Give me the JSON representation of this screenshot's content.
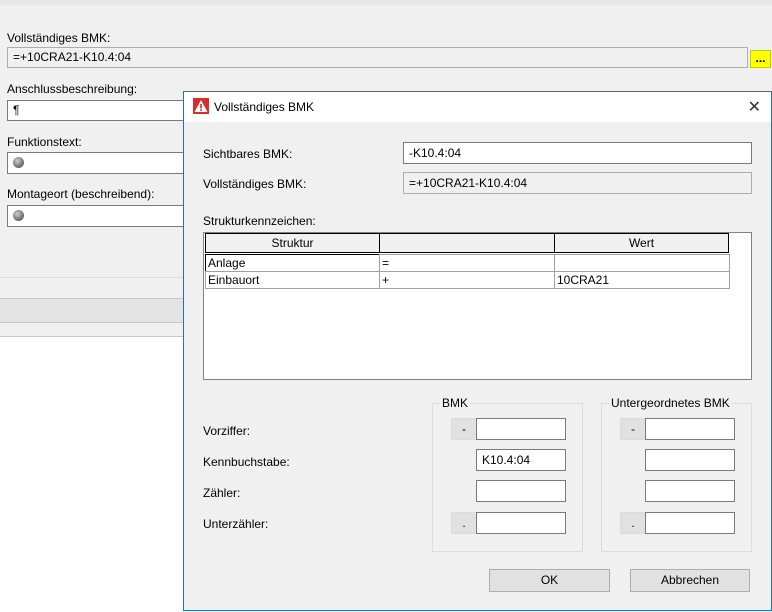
{
  "background_form": {
    "bmk_label": "Vollständiges BMK:",
    "bmk_value": "=+10CRA21-K10.4:04",
    "browse_label": "...",
    "anschluss_label": "Anschlussbeschreibung:",
    "anschluss_value": "¶",
    "funktion_label": "Funktionstext:",
    "montage_label": "Montageort (beschreibend):"
  },
  "dialog": {
    "title": "Vollständiges BMK",
    "sichtbares_label": "Sichtbares BMK:",
    "sichtbares_value": "-K10.4:04",
    "vollstaendiges_label": "Vollständiges BMK:",
    "vollstaendiges_value": "=+10CRA21-K10.4:04",
    "struktur_heading": "Strukturkennzeichen:",
    "table": {
      "headers": [
        "Struktur",
        "",
        "Wert"
      ],
      "rows": [
        [
          "Anlage",
          "=",
          ""
        ],
        [
          "Einbauort",
          "+",
          "10CRA21"
        ]
      ]
    },
    "row_labels": {
      "vorziffer": "Vorziffer:",
      "kennbuchstabe": "Kennbuchstabe:",
      "zaehler": "Zähler:",
      "unterzaehler": "Unterzähler:"
    },
    "bmk_group": {
      "title": "BMK",
      "vorziffer_prefix": "-",
      "vorziffer_value": "",
      "kennbuchstabe_value": "K10.4:04",
      "zaehler_value": "",
      "unterzaehler_prefix": ".",
      "unterzaehler_value": ""
    },
    "sub_group": {
      "title": "Untergeordnetes BMK",
      "vorziffer_prefix": "-",
      "unterzaehler_prefix": "."
    },
    "ok_label": "OK",
    "cancel_label": "Abbrechen"
  },
  "colors": {
    "accent_border": "#1a73c8",
    "browse_button": "#ffff00",
    "warning_icon": "#d32f2f"
  }
}
